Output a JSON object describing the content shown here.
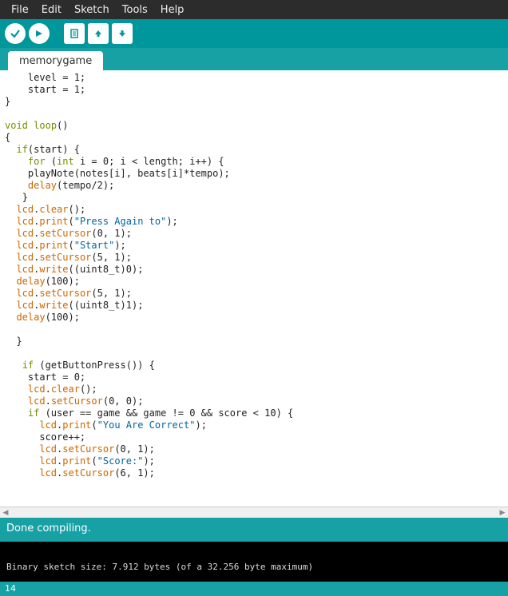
{
  "menubar": {
    "file": "File",
    "edit": "Edit",
    "sketch": "Sketch",
    "tools": "Tools",
    "help": "Help"
  },
  "tab": {
    "name": "memorygame"
  },
  "code": {
    "lines": [
      {
        "indent": 4,
        "tokens": [
          {
            "t": "plain",
            "v": "level = 1;"
          }
        ]
      },
      {
        "indent": 4,
        "tokens": [
          {
            "t": "plain",
            "v": "start = 1;"
          }
        ]
      },
      {
        "indent": 0,
        "tokens": [
          {
            "t": "plain",
            "v": "}"
          }
        ]
      },
      {
        "indent": 0,
        "tokens": []
      },
      {
        "indent": 0,
        "tokens": [
          {
            "t": "kw-green",
            "v": "void"
          },
          {
            "t": "plain",
            "v": " "
          },
          {
            "t": "kw-green",
            "v": "loop"
          },
          {
            "t": "plain",
            "v": "()"
          }
        ]
      },
      {
        "indent": 0,
        "tokens": [
          {
            "t": "plain",
            "v": "{"
          }
        ]
      },
      {
        "indent": 2,
        "tokens": [
          {
            "t": "kw-green",
            "v": "if"
          },
          {
            "t": "plain",
            "v": "(start) {"
          }
        ]
      },
      {
        "indent": 4,
        "tokens": [
          {
            "t": "kw-green",
            "v": "for"
          },
          {
            "t": "plain",
            "v": " ("
          },
          {
            "t": "kw-green",
            "v": "int"
          },
          {
            "t": "plain",
            "v": " i = 0; i < length; i++) {"
          }
        ]
      },
      {
        "indent": 4,
        "tokens": [
          {
            "t": "plain",
            "v": "playNote(notes[i], beats[i]*tempo);"
          }
        ]
      },
      {
        "indent": 4,
        "tokens": [
          {
            "t": "kw-orange",
            "v": "delay"
          },
          {
            "t": "plain",
            "v": "(tempo/2);"
          }
        ]
      },
      {
        "indent": 3,
        "tokens": [
          {
            "t": "plain",
            "v": "}"
          }
        ]
      },
      {
        "indent": 2,
        "tokens": [
          {
            "t": "kw-orange",
            "v": "lcd"
          },
          {
            "t": "plain",
            "v": "."
          },
          {
            "t": "kw-orange",
            "v": "clear"
          },
          {
            "t": "plain",
            "v": "();"
          }
        ]
      },
      {
        "indent": 2,
        "tokens": [
          {
            "t": "kw-orange",
            "v": "lcd"
          },
          {
            "t": "plain",
            "v": "."
          },
          {
            "t": "kw-orange",
            "v": "print"
          },
          {
            "t": "plain",
            "v": "("
          },
          {
            "t": "str",
            "v": "\"Press Again to\""
          },
          {
            "t": "plain",
            "v": ");"
          }
        ]
      },
      {
        "indent": 2,
        "tokens": [
          {
            "t": "kw-orange",
            "v": "lcd"
          },
          {
            "t": "plain",
            "v": "."
          },
          {
            "t": "kw-orange",
            "v": "setCursor"
          },
          {
            "t": "plain",
            "v": "(0, 1);"
          }
        ]
      },
      {
        "indent": 2,
        "tokens": [
          {
            "t": "kw-orange",
            "v": "lcd"
          },
          {
            "t": "plain",
            "v": "."
          },
          {
            "t": "kw-orange",
            "v": "print"
          },
          {
            "t": "plain",
            "v": "("
          },
          {
            "t": "str",
            "v": "\"Start\""
          },
          {
            "t": "plain",
            "v": ");"
          }
        ]
      },
      {
        "indent": 2,
        "tokens": [
          {
            "t": "kw-orange",
            "v": "lcd"
          },
          {
            "t": "plain",
            "v": "."
          },
          {
            "t": "kw-orange",
            "v": "setCursor"
          },
          {
            "t": "plain",
            "v": "(5, 1);"
          }
        ]
      },
      {
        "indent": 2,
        "tokens": [
          {
            "t": "kw-orange",
            "v": "lcd"
          },
          {
            "t": "plain",
            "v": "."
          },
          {
            "t": "kw-orange",
            "v": "write"
          },
          {
            "t": "plain",
            "v": "((uint8_t)0);"
          }
        ]
      },
      {
        "indent": 2,
        "tokens": [
          {
            "t": "kw-orange",
            "v": "delay"
          },
          {
            "t": "plain",
            "v": "(100);"
          }
        ]
      },
      {
        "indent": 2,
        "tokens": [
          {
            "t": "kw-orange",
            "v": "lcd"
          },
          {
            "t": "plain",
            "v": "."
          },
          {
            "t": "kw-orange",
            "v": "setCursor"
          },
          {
            "t": "plain",
            "v": "(5, 1);"
          }
        ]
      },
      {
        "indent": 2,
        "tokens": [
          {
            "t": "kw-orange",
            "v": "lcd"
          },
          {
            "t": "plain",
            "v": "."
          },
          {
            "t": "kw-orange",
            "v": "write"
          },
          {
            "t": "plain",
            "v": "((uint8_t)1);"
          }
        ]
      },
      {
        "indent": 2,
        "tokens": [
          {
            "t": "kw-orange",
            "v": "delay"
          },
          {
            "t": "plain",
            "v": "(100);"
          }
        ]
      },
      {
        "indent": 0,
        "tokens": []
      },
      {
        "indent": 2,
        "tokens": [
          {
            "t": "plain",
            "v": "}"
          }
        ]
      },
      {
        "indent": 0,
        "tokens": []
      },
      {
        "indent": 3,
        "tokens": [
          {
            "t": "kw-green",
            "v": "if"
          },
          {
            "t": "plain",
            "v": " (getButtonPress()) {"
          }
        ]
      },
      {
        "indent": 4,
        "tokens": [
          {
            "t": "plain",
            "v": "start = 0;"
          }
        ]
      },
      {
        "indent": 4,
        "tokens": [
          {
            "t": "kw-orange",
            "v": "lcd"
          },
          {
            "t": "plain",
            "v": "."
          },
          {
            "t": "kw-orange",
            "v": "clear"
          },
          {
            "t": "plain",
            "v": "();"
          }
        ]
      },
      {
        "indent": 4,
        "tokens": [
          {
            "t": "kw-orange",
            "v": "lcd"
          },
          {
            "t": "plain",
            "v": "."
          },
          {
            "t": "kw-orange",
            "v": "setCursor"
          },
          {
            "t": "plain",
            "v": "(0, 0);"
          }
        ]
      },
      {
        "indent": 4,
        "tokens": [
          {
            "t": "kw-green",
            "v": "if"
          },
          {
            "t": "plain",
            "v": " (user == game && game != 0 && score < 10) {"
          }
        ]
      },
      {
        "indent": 6,
        "tokens": [
          {
            "t": "kw-orange",
            "v": "lcd"
          },
          {
            "t": "plain",
            "v": "."
          },
          {
            "t": "kw-orange",
            "v": "print"
          },
          {
            "t": "plain",
            "v": "("
          },
          {
            "t": "str",
            "v": "\"You Are Correct\""
          },
          {
            "t": "plain",
            "v": ");"
          }
        ]
      },
      {
        "indent": 6,
        "tokens": [
          {
            "t": "plain",
            "v": "score++;"
          }
        ]
      },
      {
        "indent": 6,
        "tokens": [
          {
            "t": "kw-orange",
            "v": "lcd"
          },
          {
            "t": "plain",
            "v": "."
          },
          {
            "t": "kw-orange",
            "v": "setCursor"
          },
          {
            "t": "plain",
            "v": "(0, 1);"
          }
        ]
      },
      {
        "indent": 6,
        "tokens": [
          {
            "t": "kw-orange",
            "v": "lcd"
          },
          {
            "t": "plain",
            "v": "."
          },
          {
            "t": "kw-orange",
            "v": "print"
          },
          {
            "t": "plain",
            "v": "("
          },
          {
            "t": "str",
            "v": "\"Score:\""
          },
          {
            "t": "plain",
            "v": ");"
          }
        ]
      },
      {
        "indent": 6,
        "tokens": [
          {
            "t": "kw-orange",
            "v": "lcd"
          },
          {
            "t": "plain",
            "v": "."
          },
          {
            "t": "kw-orange",
            "v": "setCursor"
          },
          {
            "t": "plain",
            "v": "(6, 1);"
          }
        ]
      }
    ]
  },
  "status": {
    "message": "Done compiling."
  },
  "console": {
    "text": "Binary sketch size: 7.912 bytes (of a 32.256 byte maximum)"
  },
  "footer": {
    "line": "14"
  }
}
